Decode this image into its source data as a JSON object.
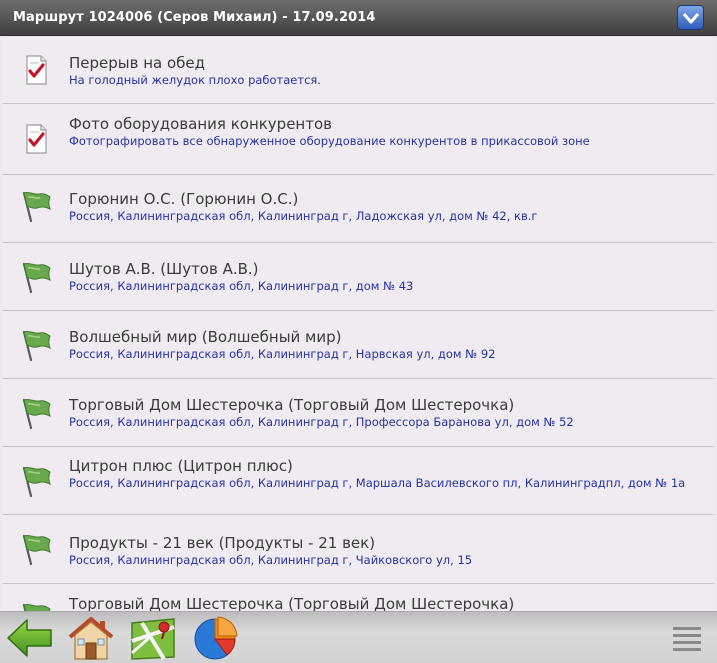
{
  "header": {
    "title": "Маршрут 1024006 (Серов Михаил) - 17.09.2014"
  },
  "rows": [
    {
      "icon": "task-icon",
      "title": "Перерыв на обед",
      "subtitle": "На голодный желудок плохо работается."
    },
    {
      "icon": "task-icon",
      "title": "Фото оборудования конкурентов",
      "subtitle": "Фотографировать все обнаруженное оборудование конкурентов в прикассовой зоне"
    },
    {
      "icon": "flag-icon",
      "title": "Горюнин О.С. (Горюнин О.С.)",
      "subtitle": "Россия, Калининградская обл, Калининград г, Ладожская ул, дом № 42, кв.г"
    },
    {
      "icon": "flag-icon",
      "title": "Шутов А.В. (Шутов А.В.)",
      "subtitle": "Россия, Калининградская обл, Калининград г, дом № 43"
    },
    {
      "icon": "flag-icon",
      "title": "Волшебный мир (Волшебный мир)",
      "subtitle": "Россия, Калининградская обл, Калининград г, Нарвская ул, дом № 92"
    },
    {
      "icon": "flag-icon",
      "title": "Торговый Дом Шестерочка (Торговый Дом Шестерочка)",
      "subtitle": "Россия, Калининградская обл, Калининград г, Профессора Баранова ул, дом № 52"
    },
    {
      "icon": "flag-icon",
      "title": "Цитрон плюс (Цитрон плюс)",
      "subtitle": "Россия, Калининградская обл, Калининград г, Маршала Василевского пл, Калининградпл, дом № 1а"
    },
    {
      "icon": "flag-icon",
      "title": "Продукты - 21 век (Продукты - 21 век)",
      "subtitle": "Россия, Калининградская обл, Калининград г, Чайковского ул, 15"
    },
    {
      "icon": "flag-icon",
      "title": "Торговый Дом Шестерочка (Торговый Дом Шестерочка)",
      "subtitle": ""
    }
  ],
  "toolbar": {
    "buttons": [
      "back-arrow-icon",
      "home-icon",
      "map-icon",
      "pie-chart-icon",
      "menu-icon"
    ]
  },
  "colors": {
    "header_bg": "#4f4f4f",
    "row_bg": "#f0eaf1",
    "title_text": "#3b3b3b",
    "subtitle_text": "#2535a5",
    "accent_blue": "#2f5bb8",
    "flag_green": "#6aa84f",
    "check_red": "#c0182a"
  }
}
